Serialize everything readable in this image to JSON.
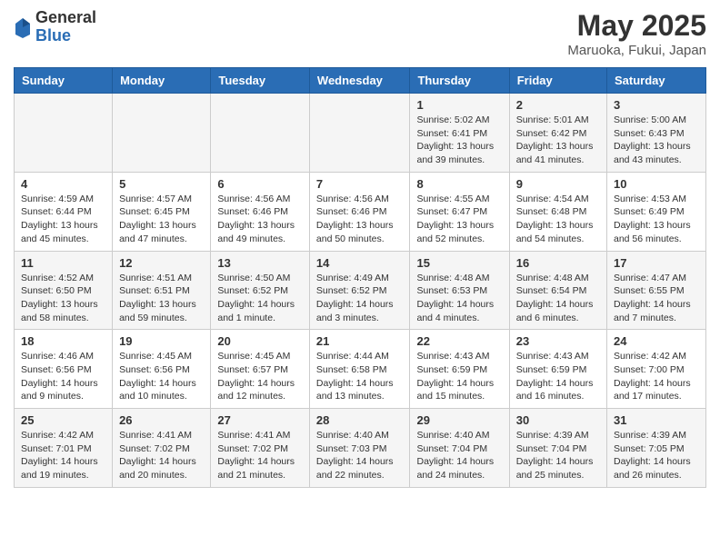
{
  "header": {
    "logo_general": "General",
    "logo_blue": "Blue",
    "title": "May 2025",
    "location": "Maruoka, Fukui, Japan"
  },
  "days_of_week": [
    "Sunday",
    "Monday",
    "Tuesday",
    "Wednesday",
    "Thursday",
    "Friday",
    "Saturday"
  ],
  "weeks": [
    [
      {
        "day": "",
        "info": ""
      },
      {
        "day": "",
        "info": ""
      },
      {
        "day": "",
        "info": ""
      },
      {
        "day": "",
        "info": ""
      },
      {
        "day": "1",
        "info": "Sunrise: 5:02 AM\nSunset: 6:41 PM\nDaylight: 13 hours\nand 39 minutes."
      },
      {
        "day": "2",
        "info": "Sunrise: 5:01 AM\nSunset: 6:42 PM\nDaylight: 13 hours\nand 41 minutes."
      },
      {
        "day": "3",
        "info": "Sunrise: 5:00 AM\nSunset: 6:43 PM\nDaylight: 13 hours\nand 43 minutes."
      }
    ],
    [
      {
        "day": "4",
        "info": "Sunrise: 4:59 AM\nSunset: 6:44 PM\nDaylight: 13 hours\nand 45 minutes."
      },
      {
        "day": "5",
        "info": "Sunrise: 4:57 AM\nSunset: 6:45 PM\nDaylight: 13 hours\nand 47 minutes."
      },
      {
        "day": "6",
        "info": "Sunrise: 4:56 AM\nSunset: 6:46 PM\nDaylight: 13 hours\nand 49 minutes."
      },
      {
        "day": "7",
        "info": "Sunrise: 4:56 AM\nSunset: 6:46 PM\nDaylight: 13 hours\nand 50 minutes."
      },
      {
        "day": "8",
        "info": "Sunrise: 4:55 AM\nSunset: 6:47 PM\nDaylight: 13 hours\nand 52 minutes."
      },
      {
        "day": "9",
        "info": "Sunrise: 4:54 AM\nSunset: 6:48 PM\nDaylight: 13 hours\nand 54 minutes."
      },
      {
        "day": "10",
        "info": "Sunrise: 4:53 AM\nSunset: 6:49 PM\nDaylight: 13 hours\nand 56 minutes."
      }
    ],
    [
      {
        "day": "11",
        "info": "Sunrise: 4:52 AM\nSunset: 6:50 PM\nDaylight: 13 hours\nand 58 minutes."
      },
      {
        "day": "12",
        "info": "Sunrise: 4:51 AM\nSunset: 6:51 PM\nDaylight: 13 hours\nand 59 minutes."
      },
      {
        "day": "13",
        "info": "Sunrise: 4:50 AM\nSunset: 6:52 PM\nDaylight: 14 hours\nand 1 minute."
      },
      {
        "day": "14",
        "info": "Sunrise: 4:49 AM\nSunset: 6:52 PM\nDaylight: 14 hours\nand 3 minutes."
      },
      {
        "day": "15",
        "info": "Sunrise: 4:48 AM\nSunset: 6:53 PM\nDaylight: 14 hours\nand 4 minutes."
      },
      {
        "day": "16",
        "info": "Sunrise: 4:48 AM\nSunset: 6:54 PM\nDaylight: 14 hours\nand 6 minutes."
      },
      {
        "day": "17",
        "info": "Sunrise: 4:47 AM\nSunset: 6:55 PM\nDaylight: 14 hours\nand 7 minutes."
      }
    ],
    [
      {
        "day": "18",
        "info": "Sunrise: 4:46 AM\nSunset: 6:56 PM\nDaylight: 14 hours\nand 9 minutes."
      },
      {
        "day": "19",
        "info": "Sunrise: 4:45 AM\nSunset: 6:56 PM\nDaylight: 14 hours\nand 10 minutes."
      },
      {
        "day": "20",
        "info": "Sunrise: 4:45 AM\nSunset: 6:57 PM\nDaylight: 14 hours\nand 12 minutes."
      },
      {
        "day": "21",
        "info": "Sunrise: 4:44 AM\nSunset: 6:58 PM\nDaylight: 14 hours\nand 13 minutes."
      },
      {
        "day": "22",
        "info": "Sunrise: 4:43 AM\nSunset: 6:59 PM\nDaylight: 14 hours\nand 15 minutes."
      },
      {
        "day": "23",
        "info": "Sunrise: 4:43 AM\nSunset: 6:59 PM\nDaylight: 14 hours\nand 16 minutes."
      },
      {
        "day": "24",
        "info": "Sunrise: 4:42 AM\nSunset: 7:00 PM\nDaylight: 14 hours\nand 17 minutes."
      }
    ],
    [
      {
        "day": "25",
        "info": "Sunrise: 4:42 AM\nSunset: 7:01 PM\nDaylight: 14 hours\nand 19 minutes."
      },
      {
        "day": "26",
        "info": "Sunrise: 4:41 AM\nSunset: 7:02 PM\nDaylight: 14 hours\nand 20 minutes."
      },
      {
        "day": "27",
        "info": "Sunrise: 4:41 AM\nSunset: 7:02 PM\nDaylight: 14 hours\nand 21 minutes."
      },
      {
        "day": "28",
        "info": "Sunrise: 4:40 AM\nSunset: 7:03 PM\nDaylight: 14 hours\nand 22 minutes."
      },
      {
        "day": "29",
        "info": "Sunrise: 4:40 AM\nSunset: 7:04 PM\nDaylight: 14 hours\nand 24 minutes."
      },
      {
        "day": "30",
        "info": "Sunrise: 4:39 AM\nSunset: 7:04 PM\nDaylight: 14 hours\nand 25 minutes."
      },
      {
        "day": "31",
        "info": "Sunrise: 4:39 AM\nSunset: 7:05 PM\nDaylight: 14 hours\nand 26 minutes."
      }
    ]
  ]
}
